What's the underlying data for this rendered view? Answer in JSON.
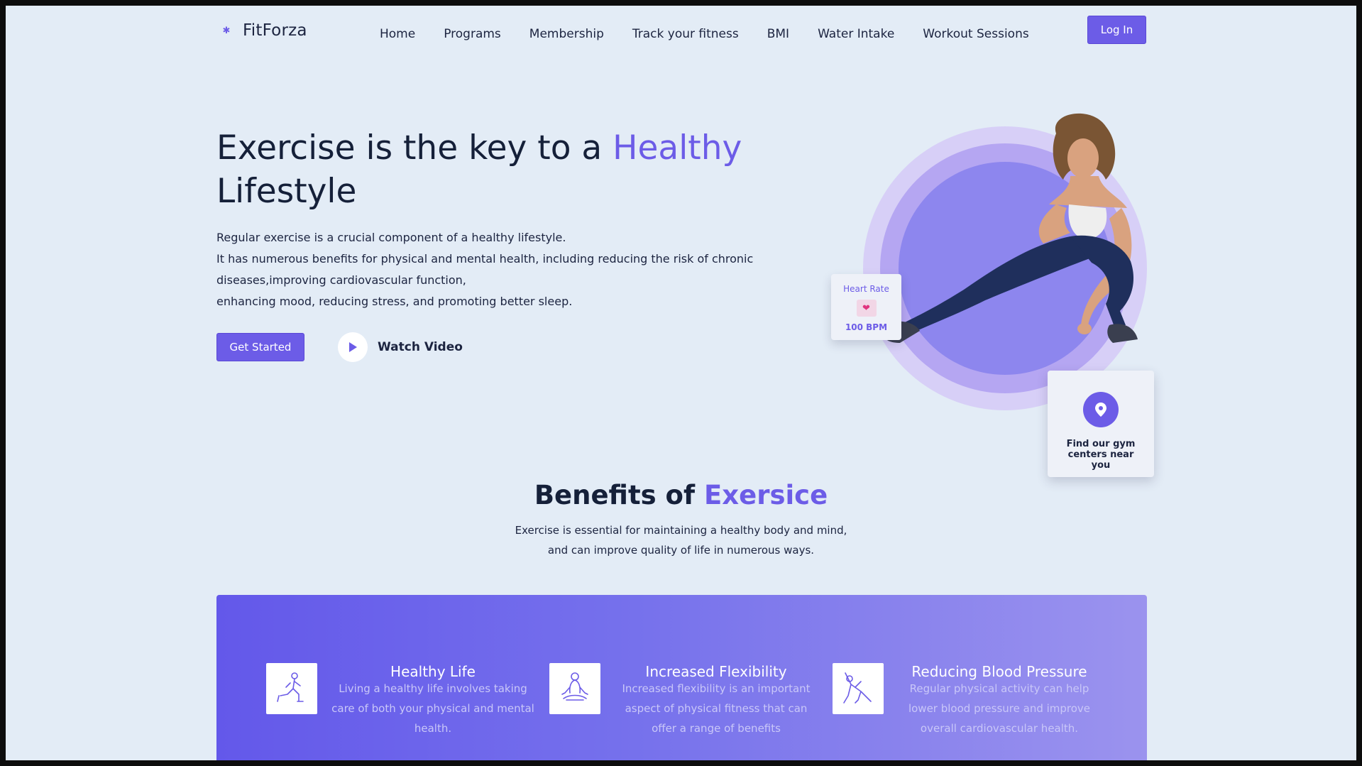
{
  "brand": {
    "name": "FitForza"
  },
  "nav": {
    "links": [
      "Home",
      "Programs",
      "Membership",
      "Track your fitness",
      "BMI",
      "Water Intake",
      "Workout Sessions"
    ],
    "login_label": "Log In"
  },
  "hero": {
    "title_part1": "Exercise is the key to a ",
    "title_accent": "Healthy",
    "title_part2": "Lifestyle",
    "desc": [
      "Regular exercise is a crucial component of a healthy lifestyle.",
      "It has numerous benefits for physical and mental health, including reducing the risk of chronic diseases,improving cardiovascular function,",
      "enhancing mood, reducing stress, and promoting better sleep."
    ],
    "cta_label": "Get Started",
    "watch_label": "Watch Video"
  },
  "heart_rate": {
    "title": "Heart Rate",
    "value": "100 BPM"
  },
  "gym_card": {
    "text": "Find our gym centers near you"
  },
  "benefits": {
    "title_part1": "Benefits of ",
    "title_accent": "Exersice",
    "subtitle_line1": "Exercise is essential for maintaining a healthy body and mind,",
    "subtitle_line2": "and can improve quality of life in numerous ways.",
    "items": [
      {
        "title": "Healthy Life",
        "text": "Living a healthy life involves taking care of both your physical and mental health.",
        "icon": "lunge-figure-icon"
      },
      {
        "title": "Increased Flexibility",
        "text": "Increased flexibility is an important aspect of physical fitness that can offer a range of benefits",
        "icon": "meditation-figure-icon"
      },
      {
        "title": "Reducing Blood Pressure",
        "text": "Regular physical activity can help lower blood pressure and improve overall cardiovascular health.",
        "icon": "stretch-figure-icon"
      }
    ]
  },
  "colors": {
    "accent": "#6c5ce7",
    "background": "#e3ecf6",
    "text": "#152039"
  }
}
